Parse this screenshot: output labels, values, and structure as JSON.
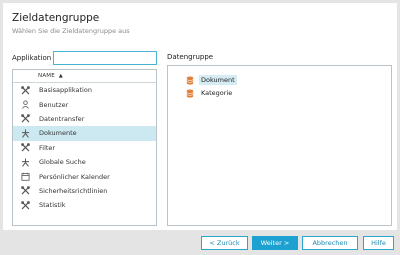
{
  "dialog": {
    "title": "Zieldatengruppe",
    "subtitle": "Wählen Sie die Zieldatengruppe aus"
  },
  "application": {
    "label": "Applikation",
    "search_value": "",
    "column_name": "NAME",
    "sort_indicator": "▲",
    "items": [
      {
        "label": "Basisapplikation",
        "icon": "tools-icon",
        "selected": false
      },
      {
        "label": "Benutzer",
        "icon": "user-icon",
        "selected": false
      },
      {
        "label": "Datentransfer",
        "icon": "tools-icon",
        "selected": false
      },
      {
        "label": "Dokumente",
        "icon": "people-icon",
        "selected": true
      },
      {
        "label": "Filter",
        "icon": "tools-icon",
        "selected": false
      },
      {
        "label": "Globale Suche",
        "icon": "people-icon",
        "selected": false
      },
      {
        "label": "Persönlicher Kalender",
        "icon": "calendar-icon",
        "selected": false
      },
      {
        "label": "Sicherheitsrichtlinien",
        "icon": "tools-icon",
        "selected": false
      },
      {
        "label": "Statistik",
        "icon": "tools-icon",
        "selected": false
      }
    ]
  },
  "datengruppe": {
    "label": "Datengruppe",
    "items": [
      {
        "label": "Dokument",
        "icon": "database-icon",
        "selected": true
      },
      {
        "label": "Kategorie",
        "icon": "database-icon",
        "selected": false
      }
    ]
  },
  "buttons": {
    "back": "< Zurück",
    "next": "Weiter >",
    "cancel": "Abbrechen",
    "help": "Hilfe"
  },
  "colors": {
    "accent": "#1da1d0",
    "selection": "#cce9f2",
    "database_icon": "#e0813a"
  }
}
